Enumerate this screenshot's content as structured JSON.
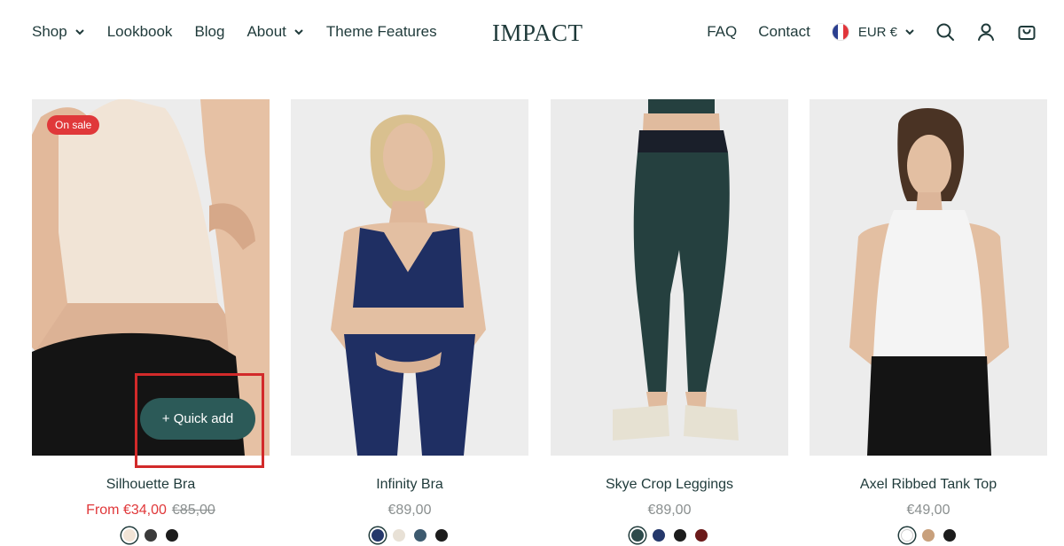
{
  "header": {
    "logo": "IMPACT",
    "nav_left": [
      {
        "label": "Shop",
        "dropdown": true
      },
      {
        "label": "Lookbook",
        "dropdown": false
      },
      {
        "label": "Blog",
        "dropdown": false
      },
      {
        "label": "About",
        "dropdown": true
      },
      {
        "label": "Theme Features",
        "dropdown": false
      }
    ],
    "nav_right": [
      {
        "label": "FAQ"
      },
      {
        "label": "Contact"
      }
    ],
    "currency": "EUR €",
    "icons": [
      "search-icon",
      "account-icon",
      "cart-icon"
    ]
  },
  "products": [
    {
      "title": "Silhouette Bra",
      "price": "From €34,00",
      "compare_price": "€85,00",
      "on_sale": true,
      "badge": "On sale",
      "quick_add": "+ Quick add",
      "swatches": [
        "#f1e4d6",
        "#3a3a3a",
        "#1c1c1c"
      ]
    },
    {
      "title": "Infinity Bra",
      "price": "€89,00",
      "swatches": [
        "#25386b",
        "#e8e1d6",
        "#3d5a6f",
        "#1c1c1c"
      ]
    },
    {
      "title": "Skye Crop Leggings",
      "price": "€89,00",
      "swatches": [
        "#2d4a4b",
        "#25386b",
        "#1c1c1c",
        "#6b1a1a"
      ]
    },
    {
      "title": "Axel Ribbed Tank Top",
      "price": "€49,00",
      "swatches": [
        "#ffffff",
        "#c8a07c",
        "#1c1c1c"
      ]
    }
  ],
  "colors": {
    "accent": "#2c5a58",
    "sale": "#e0383a",
    "text": "#1f3a3a",
    "highlight": "#d22a2a"
  }
}
